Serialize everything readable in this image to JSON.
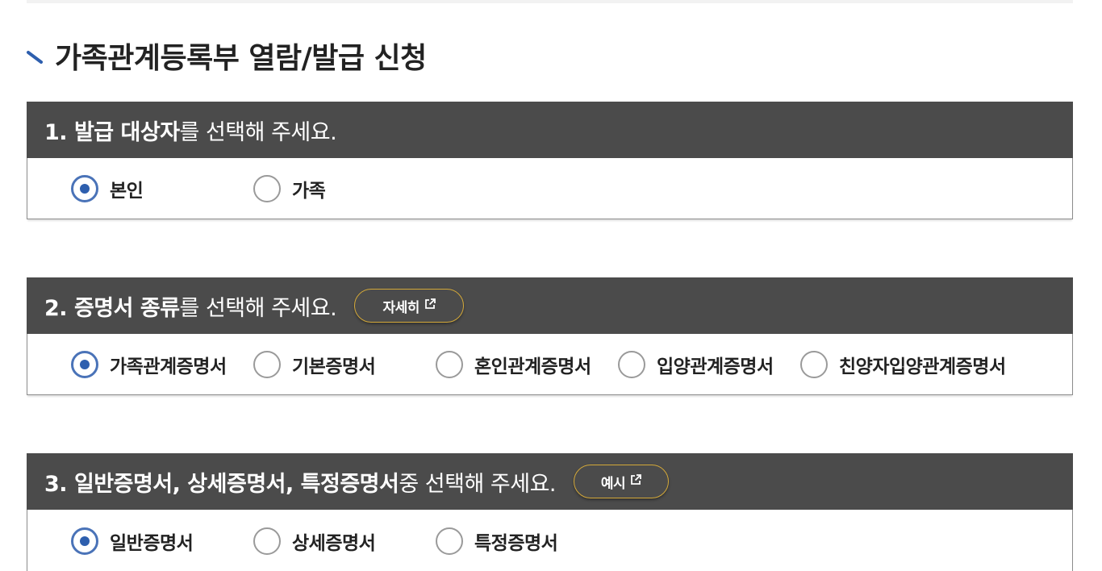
{
  "page": {
    "title": "가족관계등록부 열람/발급 신청"
  },
  "sections": [
    {
      "heading_bold": "1. 발급 대상자",
      "heading_normal": "를 선택해 주세요.",
      "options": [
        {
          "label": "본인",
          "checked": true
        },
        {
          "label": "가족",
          "checked": false
        }
      ]
    },
    {
      "heading_bold": "2. 증명서 종류",
      "heading_normal": "를 선택해 주세요.",
      "button": {
        "label": "자세히",
        "icon": "external-link-icon"
      },
      "options": [
        {
          "label": "가족관계증명서",
          "checked": true
        },
        {
          "label": "기본증명서",
          "checked": false
        },
        {
          "label": "혼인관계증명서",
          "checked": false
        },
        {
          "label": "입양관계증명서",
          "checked": false
        },
        {
          "label": "친양자입양관계증명서",
          "checked": false
        }
      ]
    },
    {
      "heading_bold": "3. 일반증명서, 상세증명서, 특정증명서",
      "heading_normal": " 중 선택해 주세요.",
      "button": {
        "label": "예시",
        "icon": "external-link-icon"
      },
      "options": [
        {
          "label": "일반증명서",
          "checked": true
        },
        {
          "label": "상세증명서",
          "checked": false
        },
        {
          "label": "특정증명서",
          "checked": false
        }
      ]
    }
  ],
  "colors": {
    "header_bg": "#4b4b4b",
    "radio_checked": "#2e5fae",
    "button_border": "#d4a93a",
    "title_mark": "#2e5fae"
  }
}
